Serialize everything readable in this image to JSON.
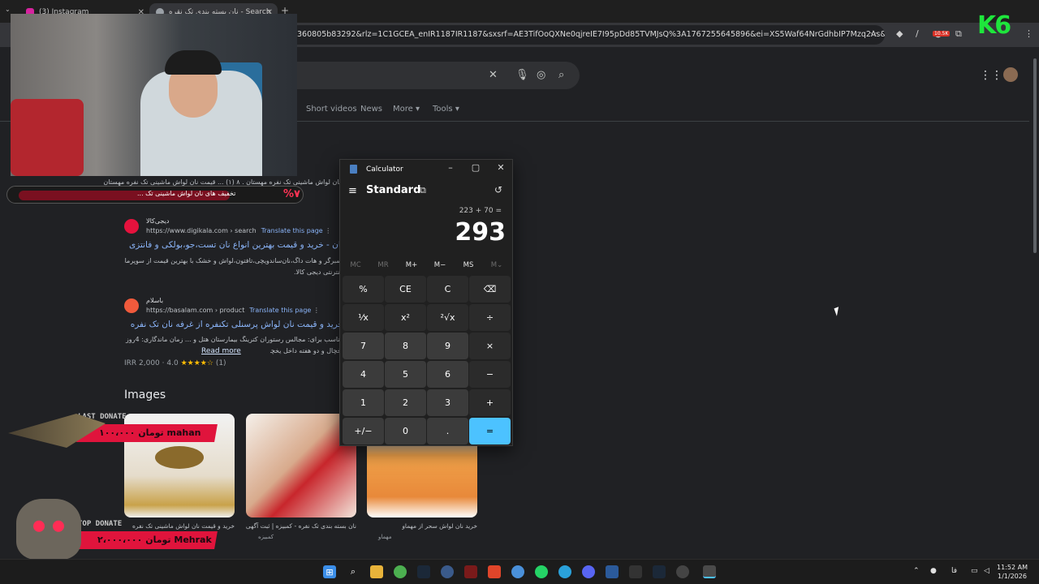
{
  "browser": {
    "tabs": [
      {
        "title": "(3) Instagram"
      },
      {
        "title": "Search - نان بسته بندی تک نقره"
      }
    ],
    "url": "360805b83292&rlz=1C1GCEA_enIR1187IR1187&sxsrf=AE3TifOoQXNe0qjreIE7I95pDd85TVMJsQ%3A1767255645896&ei=XS5Waf64NrGdhbIP7Mzq2As&oq=...نان+بسته+",
    "extension_badge": "10.5K"
  },
  "search": {
    "filters": [
      "Short videos",
      "News",
      "More",
      "Tools"
    ],
    "results": [
      {
        "site": "دیجی‌کالا",
        "url": "https://www.digikala.com › search",
        "translate": "Translate this page",
        "title": "نان - خرید و قیمت بهترین انواع نان تست،جو،بولکی و فانتزی",
        "lines": [
          "همبرگر و هات داگ،نان‌ساندویچی،تافتون،لواش و خشک با بهترین قیمت از سوپرمارکت",
          "اینترنتی دیجی کالا."
        ]
      },
      {
        "site": "باسلام",
        "url": "https://basalam.com › product",
        "translate": "Translate this page",
        "title": "خرید و قیمت نان لواش پرسنلی تکنفره از غرفه نان تک نفره",
        "lines": [
          "مناسب برای: مجالس رستوران کترینگ بیمارستان هتل و ... زمان ماندگاری: 4روز بیرون از",
          "یخچال و دو هفته داخل یخچال."
        ],
        "read_more": "Read more",
        "price": "IRR 2,000",
        "rating": "4.0",
        "stars": "★★★★☆",
        "reviews": "(1)"
      }
    ],
    "top_snippet": [
      "نان لواش ماشینی تک نفره مهستان . ۸ (۱) ... قیمت نان لواش ماشینی تک نفره مهستان",
      "تخفیف های نان لواش ماشینی تک ..."
    ],
    "images_heading": "Images",
    "images": [
      {
        "caption": "خرید و قیمت نان لواش ماشینی تک نفره",
        "source": "مهستان"
      },
      {
        "caption": "نان بسته بندی تک نفره - کمبیزه | ثبت آگهی",
        "source": "کمبیزه"
      },
      {
        "caption": "خرید نان لواش سحر از مهماو",
        "source": "مهماو"
      }
    ]
  },
  "overlays": {
    "promo_text": "تخفیف های نان لواش ماشینی تک ...",
    "promo_percent": "%۷",
    "last_donate_label": "LAST DONATE",
    "last_donate": "۱۰۰،۰۰۰ تومان mahan",
    "top_donate_label": "TOP DONATE",
    "top_donate": "۲،۰۰۰،۰۰۰ تومان Mehrak",
    "logo": "K6"
  },
  "calculator": {
    "title": "Calculator",
    "mode": "Standard",
    "expression": "223 + 70 =",
    "display": "293",
    "memory": [
      "MC",
      "MR",
      "M+",
      "M−",
      "MS",
      "M⌄"
    ],
    "keys": [
      [
        "%",
        "CE",
        "C",
        "⌫"
      ],
      [
        "¹⁄x",
        "x²",
        "²√x",
        "÷"
      ],
      [
        "7",
        "8",
        "9",
        "×"
      ],
      [
        "4",
        "5",
        "6",
        "−"
      ],
      [
        "1",
        "2",
        "3",
        "+"
      ],
      [
        "+/−",
        "0",
        ".",
        "="
      ]
    ]
  },
  "taskbar": {
    "lang": "فا",
    "time": "11:52 AM",
    "date": "1/1/2026"
  },
  "colors": {
    "accent": "#4cc2ff",
    "link": "#8ab4f8",
    "donate": "#e0143c"
  }
}
